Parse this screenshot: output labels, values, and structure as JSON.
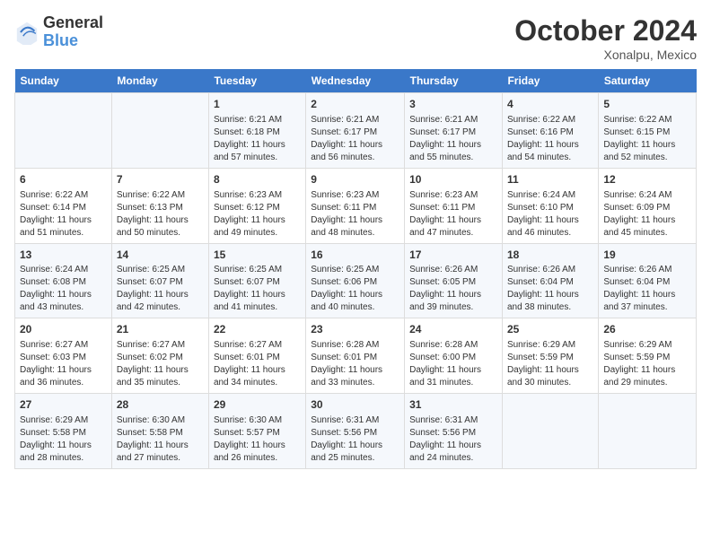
{
  "header": {
    "logo_line1": "General",
    "logo_line2": "Blue",
    "month": "October 2024",
    "location": "Xonalpu, Mexico"
  },
  "days_of_week": [
    "Sunday",
    "Monday",
    "Tuesday",
    "Wednesday",
    "Thursday",
    "Friday",
    "Saturday"
  ],
  "weeks": [
    [
      {
        "day": "",
        "info": ""
      },
      {
        "day": "",
        "info": ""
      },
      {
        "day": "1",
        "info": "Sunrise: 6:21 AM\nSunset: 6:18 PM\nDaylight: 11 hours\nand 57 minutes."
      },
      {
        "day": "2",
        "info": "Sunrise: 6:21 AM\nSunset: 6:17 PM\nDaylight: 11 hours\nand 56 minutes."
      },
      {
        "day": "3",
        "info": "Sunrise: 6:21 AM\nSunset: 6:17 PM\nDaylight: 11 hours\nand 55 minutes."
      },
      {
        "day": "4",
        "info": "Sunrise: 6:22 AM\nSunset: 6:16 PM\nDaylight: 11 hours\nand 54 minutes."
      },
      {
        "day": "5",
        "info": "Sunrise: 6:22 AM\nSunset: 6:15 PM\nDaylight: 11 hours\nand 52 minutes."
      }
    ],
    [
      {
        "day": "6",
        "info": "Sunrise: 6:22 AM\nSunset: 6:14 PM\nDaylight: 11 hours\nand 51 minutes."
      },
      {
        "day": "7",
        "info": "Sunrise: 6:22 AM\nSunset: 6:13 PM\nDaylight: 11 hours\nand 50 minutes."
      },
      {
        "day": "8",
        "info": "Sunrise: 6:23 AM\nSunset: 6:12 PM\nDaylight: 11 hours\nand 49 minutes."
      },
      {
        "day": "9",
        "info": "Sunrise: 6:23 AM\nSunset: 6:11 PM\nDaylight: 11 hours\nand 48 minutes."
      },
      {
        "day": "10",
        "info": "Sunrise: 6:23 AM\nSunset: 6:11 PM\nDaylight: 11 hours\nand 47 minutes."
      },
      {
        "day": "11",
        "info": "Sunrise: 6:24 AM\nSunset: 6:10 PM\nDaylight: 11 hours\nand 46 minutes."
      },
      {
        "day": "12",
        "info": "Sunrise: 6:24 AM\nSunset: 6:09 PM\nDaylight: 11 hours\nand 45 minutes."
      }
    ],
    [
      {
        "day": "13",
        "info": "Sunrise: 6:24 AM\nSunset: 6:08 PM\nDaylight: 11 hours\nand 43 minutes."
      },
      {
        "day": "14",
        "info": "Sunrise: 6:25 AM\nSunset: 6:07 PM\nDaylight: 11 hours\nand 42 minutes."
      },
      {
        "day": "15",
        "info": "Sunrise: 6:25 AM\nSunset: 6:07 PM\nDaylight: 11 hours\nand 41 minutes."
      },
      {
        "day": "16",
        "info": "Sunrise: 6:25 AM\nSunset: 6:06 PM\nDaylight: 11 hours\nand 40 minutes."
      },
      {
        "day": "17",
        "info": "Sunrise: 6:26 AM\nSunset: 6:05 PM\nDaylight: 11 hours\nand 39 minutes."
      },
      {
        "day": "18",
        "info": "Sunrise: 6:26 AM\nSunset: 6:04 PM\nDaylight: 11 hours\nand 38 minutes."
      },
      {
        "day": "19",
        "info": "Sunrise: 6:26 AM\nSunset: 6:04 PM\nDaylight: 11 hours\nand 37 minutes."
      }
    ],
    [
      {
        "day": "20",
        "info": "Sunrise: 6:27 AM\nSunset: 6:03 PM\nDaylight: 11 hours\nand 36 minutes."
      },
      {
        "day": "21",
        "info": "Sunrise: 6:27 AM\nSunset: 6:02 PM\nDaylight: 11 hours\nand 35 minutes."
      },
      {
        "day": "22",
        "info": "Sunrise: 6:27 AM\nSunset: 6:01 PM\nDaylight: 11 hours\nand 34 minutes."
      },
      {
        "day": "23",
        "info": "Sunrise: 6:28 AM\nSunset: 6:01 PM\nDaylight: 11 hours\nand 33 minutes."
      },
      {
        "day": "24",
        "info": "Sunrise: 6:28 AM\nSunset: 6:00 PM\nDaylight: 11 hours\nand 31 minutes."
      },
      {
        "day": "25",
        "info": "Sunrise: 6:29 AM\nSunset: 5:59 PM\nDaylight: 11 hours\nand 30 minutes."
      },
      {
        "day": "26",
        "info": "Sunrise: 6:29 AM\nSunset: 5:59 PM\nDaylight: 11 hours\nand 29 minutes."
      }
    ],
    [
      {
        "day": "27",
        "info": "Sunrise: 6:29 AM\nSunset: 5:58 PM\nDaylight: 11 hours\nand 28 minutes."
      },
      {
        "day": "28",
        "info": "Sunrise: 6:30 AM\nSunset: 5:58 PM\nDaylight: 11 hours\nand 27 minutes."
      },
      {
        "day": "29",
        "info": "Sunrise: 6:30 AM\nSunset: 5:57 PM\nDaylight: 11 hours\nand 26 minutes."
      },
      {
        "day": "30",
        "info": "Sunrise: 6:31 AM\nSunset: 5:56 PM\nDaylight: 11 hours\nand 25 minutes."
      },
      {
        "day": "31",
        "info": "Sunrise: 6:31 AM\nSunset: 5:56 PM\nDaylight: 11 hours\nand 24 minutes."
      },
      {
        "day": "",
        "info": ""
      },
      {
        "day": "",
        "info": ""
      }
    ]
  ]
}
